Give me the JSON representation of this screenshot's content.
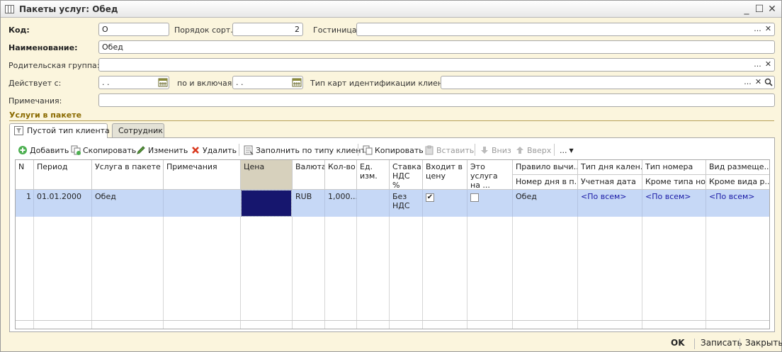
{
  "window": {
    "title": "Пакеты услуг: Обед",
    "minimize": "_",
    "maximize": "☐",
    "close": "✕"
  },
  "form": {
    "code_label": "Код:",
    "code_value": "О",
    "sort_label": "Порядок сорт.:",
    "sort_value": "2",
    "hotel_label": "Гостиница:",
    "hotel_value": "",
    "name_label": "Наименование:",
    "name_value": "Обед",
    "parent_label": "Родительская группа:",
    "parent_value": "",
    "valid_from_label": "Действует с:",
    "valid_from_value": " .  .",
    "valid_to_label": "по и включая:",
    "valid_to_value": " .  .",
    "card_type_label": "Тип карт идентификации клиентов:",
    "card_type_value": "",
    "notes_label": "Примечания:",
    "notes_value": "",
    "ellipsis": "...",
    "clear": "✕",
    "search": "🔍"
  },
  "services_section": {
    "title": "Услуги в пакете",
    "tabs": [
      {
        "label": "Пустой тип клиента"
      },
      {
        "label": "Сотрудник"
      }
    ]
  },
  "toolbar": {
    "add": "Добавить",
    "copy": "Скопировать",
    "edit": "Изменить",
    "delete": "Удалить",
    "fill_by_client_type": "Заполнить по типу клиента",
    "copy2": "Копировать",
    "paste": "Вставить",
    "down": "Вниз",
    "up": "Вверх",
    "more": "..."
  },
  "table": {
    "headers": {
      "n": "N",
      "period": "Период",
      "service": "Услуга в пакете",
      "notes": "Примечания",
      "price": "Цена",
      "currency": "Валюта",
      "qty": "Кол-во",
      "unit": "Ед. изм.",
      "vat": "Ставка НДС %",
      "in_price": "Входит в цену",
      "is_service": "Это услуга на ...",
      "calc_rule": "Правило вычи...",
      "day_number": "Номер дня в п...",
      "day_type": "Тип дня кален...",
      "account_date": "Учетная дата",
      "room_type": "Тип номера",
      "except_room_type": "Кроме типа но...",
      "placement": "Вид размеще...",
      "except_placement": "Кроме вида р..."
    },
    "rows": [
      {
        "n": "1",
        "period": "01.01.2000",
        "service": "Обед",
        "notes": "",
        "price": "",
        "currency": "RUB",
        "qty": "1,000...",
        "unit": "",
        "vat": "Без НДС",
        "in_price": true,
        "is_service": false,
        "calc_rule": "Обед",
        "day_type": "<По всем>",
        "room_type": "<По всем>",
        "placement": "<По всем>"
      }
    ]
  },
  "footer": {
    "ok": "OK",
    "save": "Записать",
    "close": "Закрыть"
  },
  "colors": {
    "background": "#fbf5dd",
    "selected_row": "#c6d8f6",
    "price_cell": "#16166e",
    "link": "#1a1aa6",
    "section_title": "#8a6a00"
  }
}
